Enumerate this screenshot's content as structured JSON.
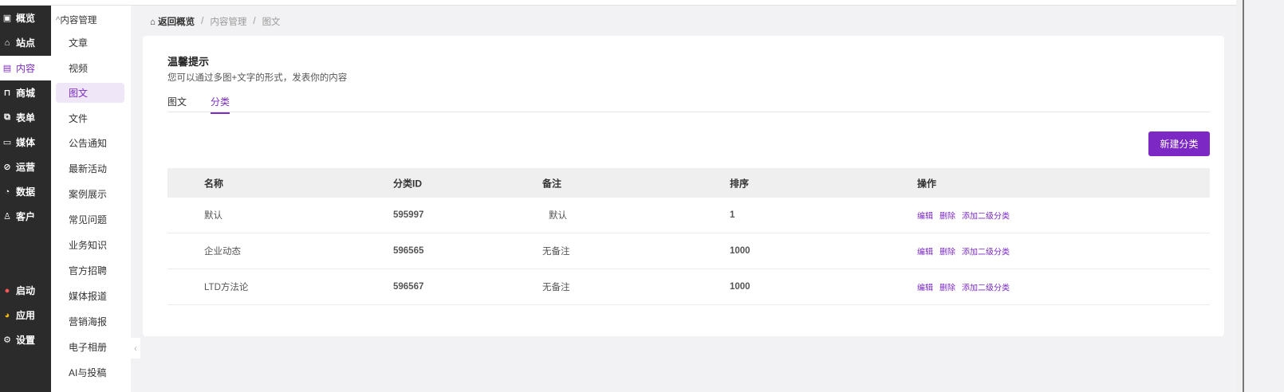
{
  "nav_primary": [
    {
      "label": "概览",
      "icon": "dashboard-icon"
    },
    {
      "label": "站点",
      "icon": "home-icon"
    },
    {
      "label": "内容",
      "icon": "document-icon",
      "active": true
    },
    {
      "label": "商城",
      "icon": "cart-icon"
    },
    {
      "label": "表单",
      "icon": "form-icon"
    },
    {
      "label": "媒体",
      "icon": "video-icon"
    },
    {
      "label": "运营",
      "icon": "paperclip-icon"
    },
    {
      "label": "数据",
      "icon": "pie-chart-icon"
    },
    {
      "label": "客户",
      "icon": "user-icon"
    }
  ],
  "nav_bottom": [
    {
      "label": "启动",
      "icon": "launch-icon"
    },
    {
      "label": "应用",
      "icon": "apps-icon"
    },
    {
      "label": "设置",
      "icon": "gear-icon"
    }
  ],
  "nav_secondary": {
    "header": "内容管理",
    "items": [
      "文章",
      "视频",
      "图文",
      "文件",
      "公告通知",
      "最新活动",
      "案例展示",
      "常见问题",
      "业务知识",
      "官方招聘",
      "媒体报道",
      "营销海报",
      "电子相册",
      "AI与投稿"
    ],
    "active": "图文"
  },
  "breadcrumb": {
    "home": "返回概览",
    "parent": "内容管理",
    "current": "图文",
    "sep": "/"
  },
  "tip": {
    "title": "温馨提示",
    "text": "您可以通过多图+文字的形式，发表你的内容"
  },
  "tabs": [
    {
      "label": "图文"
    },
    {
      "label": "分类",
      "active": true
    }
  ],
  "new_button": "新建分类",
  "table": {
    "headers": [
      "名称",
      "分类ID",
      "备注",
      "排序",
      "操作"
    ],
    "rows": [
      {
        "name": "默认",
        "id": "595997",
        "note": "默认",
        "sort": "1"
      },
      {
        "name": "企业动态",
        "id": "596565",
        "note": "无备注",
        "sort": "1000"
      },
      {
        "name": "LTD方法论",
        "id": "596567",
        "note": "无备注",
        "sort": "1000"
      }
    ],
    "actions": [
      "编辑",
      "删除",
      "添加二级分类"
    ]
  },
  "accent": "#7b28c4"
}
